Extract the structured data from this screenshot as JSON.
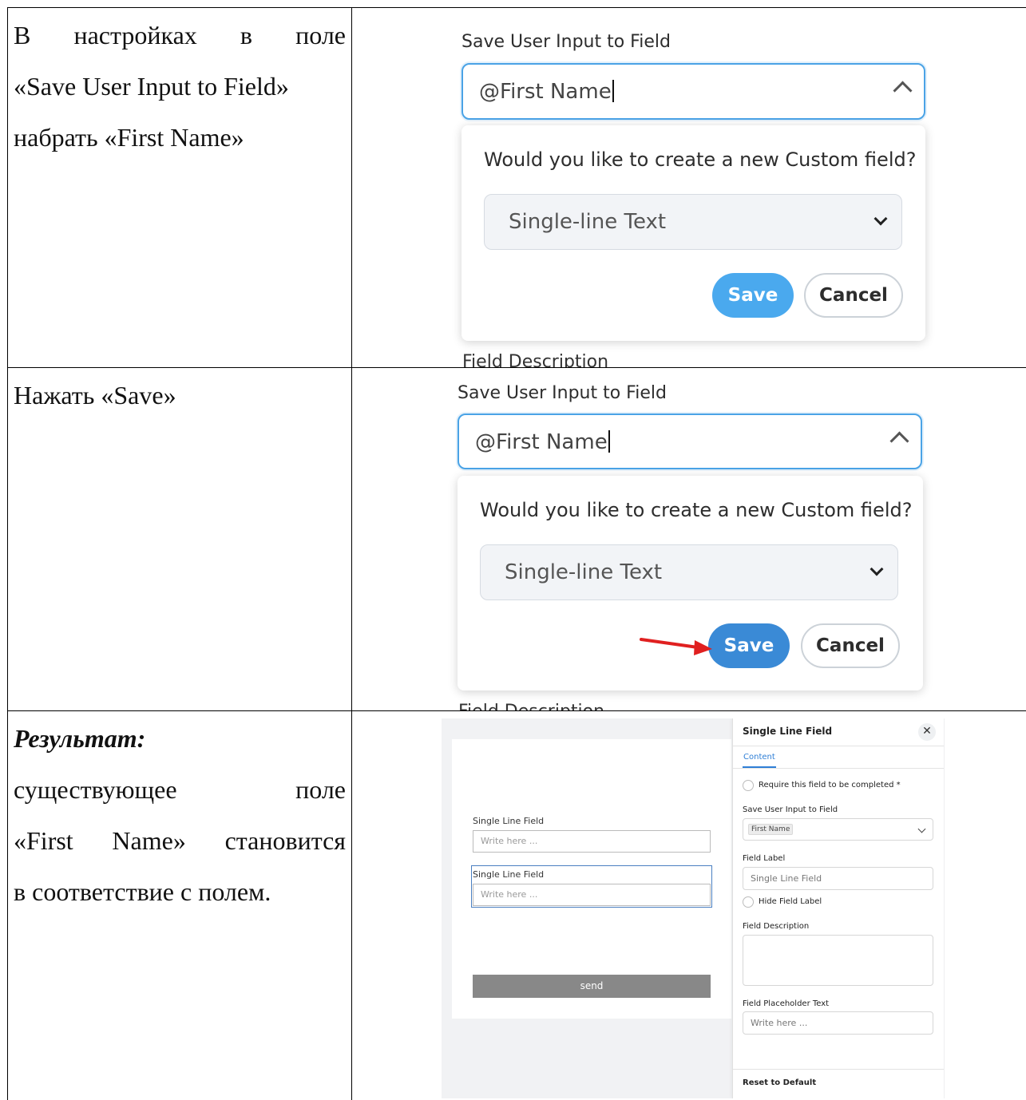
{
  "rows": [
    {
      "instruction": {
        "line1_words": [
          "В",
          "настройках",
          "в",
          "поле"
        ],
        "line2": "«Save User Input to Field»",
        "line3": "набрать «First Name»"
      },
      "screenshot": {
        "field_label": "Save User Input to Field",
        "input_value": "@First Name",
        "popup_question": "Would you like to create a new Custom field?",
        "select_value": "Single-line Text",
        "save_label": "Save",
        "cancel_label": "Cancel",
        "cut_text": "Field Description",
        "save_color": "#4aa9ee"
      }
    },
    {
      "instruction": {
        "line1": "Нажать «Save»"
      },
      "screenshot": {
        "field_label": "Save User Input to Field",
        "input_value": "@First Name",
        "popup_question": "Would you like to create a new Custom field?",
        "select_value": "Single-line Text",
        "save_label": "Save",
        "cancel_label": "Cancel",
        "cut_text": "Field Description",
        "save_color": "#3a8ad6",
        "arrow_color": "#e02020"
      }
    },
    {
      "instruction": {
        "heading": "Результат:",
        "line2_words": [
          "существующее",
          "поле"
        ],
        "line3_words": [
          "«First",
          "Name»",
          "становится"
        ],
        "line4": "в соответствие с полем."
      },
      "screenshot": {
        "form": {
          "field1_label": "Single Line Field",
          "field1_placeholder": "Write here ...",
          "field2_label": "Single Line Field",
          "field2_placeholder": "Write here ...",
          "send_label": "send"
        },
        "panel": {
          "title": "Single Line Field",
          "close_glyph": "✕",
          "tab_content": "Content",
          "require_label": "Require this field to be completed *",
          "save_input_label": "Save User Input to Field",
          "save_input_value": "First Name",
          "field_label_label": "Field Label",
          "field_label_value": "Single Line Field",
          "hide_label": "Hide Field Label",
          "description_label": "Field Description",
          "placeholder_label": "Field Placeholder Text",
          "placeholder_value": "Write here ...",
          "reset_label": "Reset to Default"
        }
      }
    }
  ]
}
